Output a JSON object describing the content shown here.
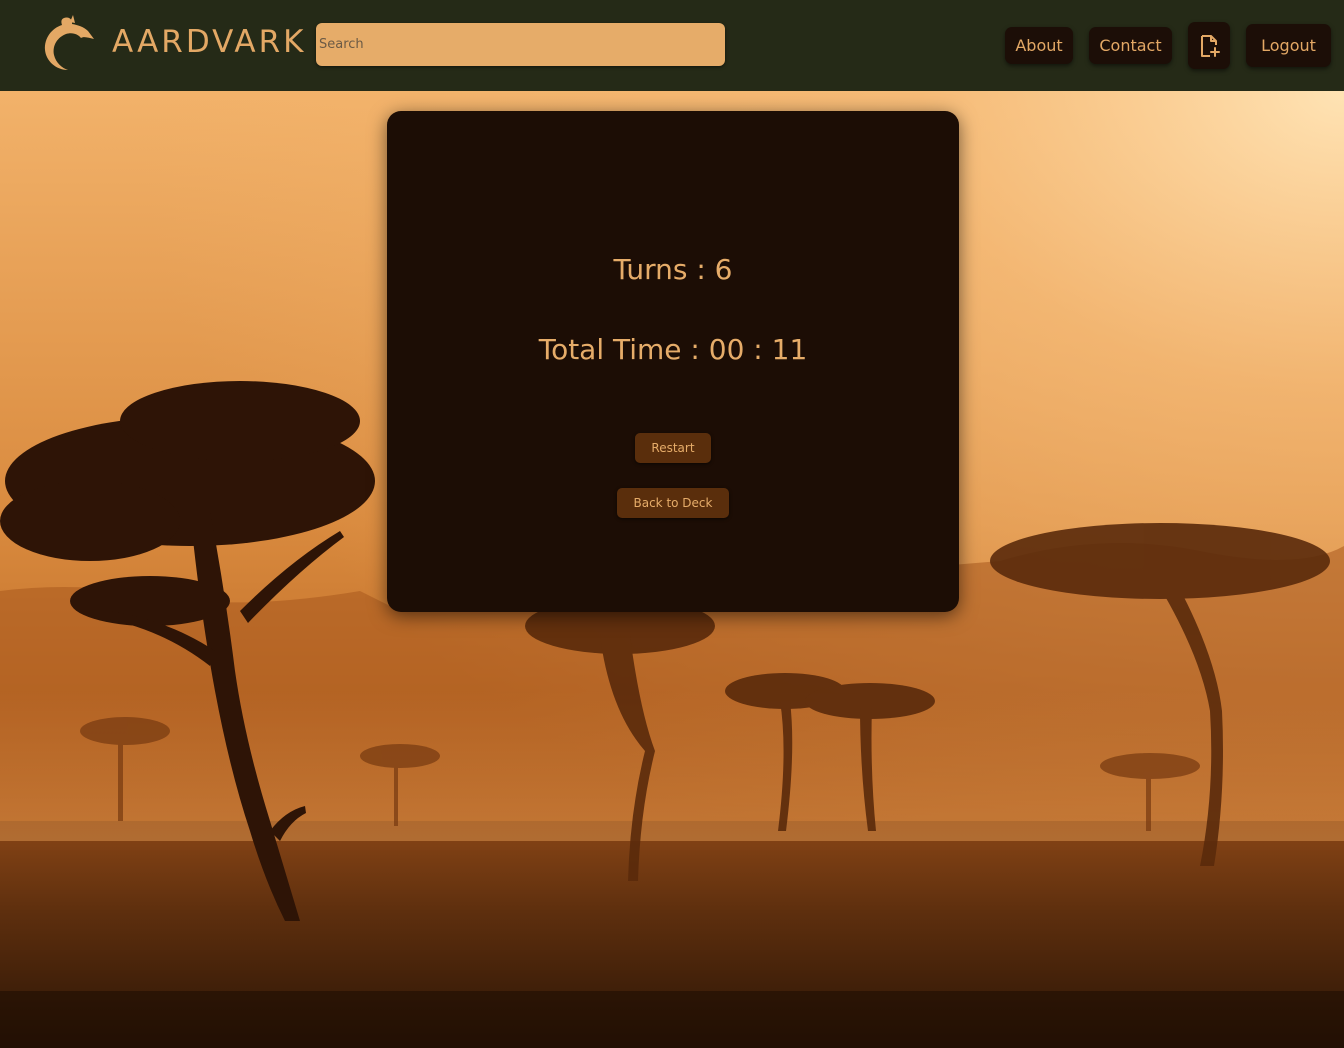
{
  "header": {
    "brand": "AARDVARK",
    "search_placeholder": "Search",
    "nav": {
      "about": "About",
      "contact": "Contact",
      "logout": "Logout"
    }
  },
  "result": {
    "turns_text": "Turns : 6",
    "time_text": "Total Time : 00 : 11",
    "restart_label": "Restart",
    "back_label": "Back to Deck"
  },
  "colors": {
    "header_bg": "#252a17",
    "accent": "#e6ac69",
    "card_bg": "#1c0d05",
    "button_bg": "#5a2e0c"
  }
}
